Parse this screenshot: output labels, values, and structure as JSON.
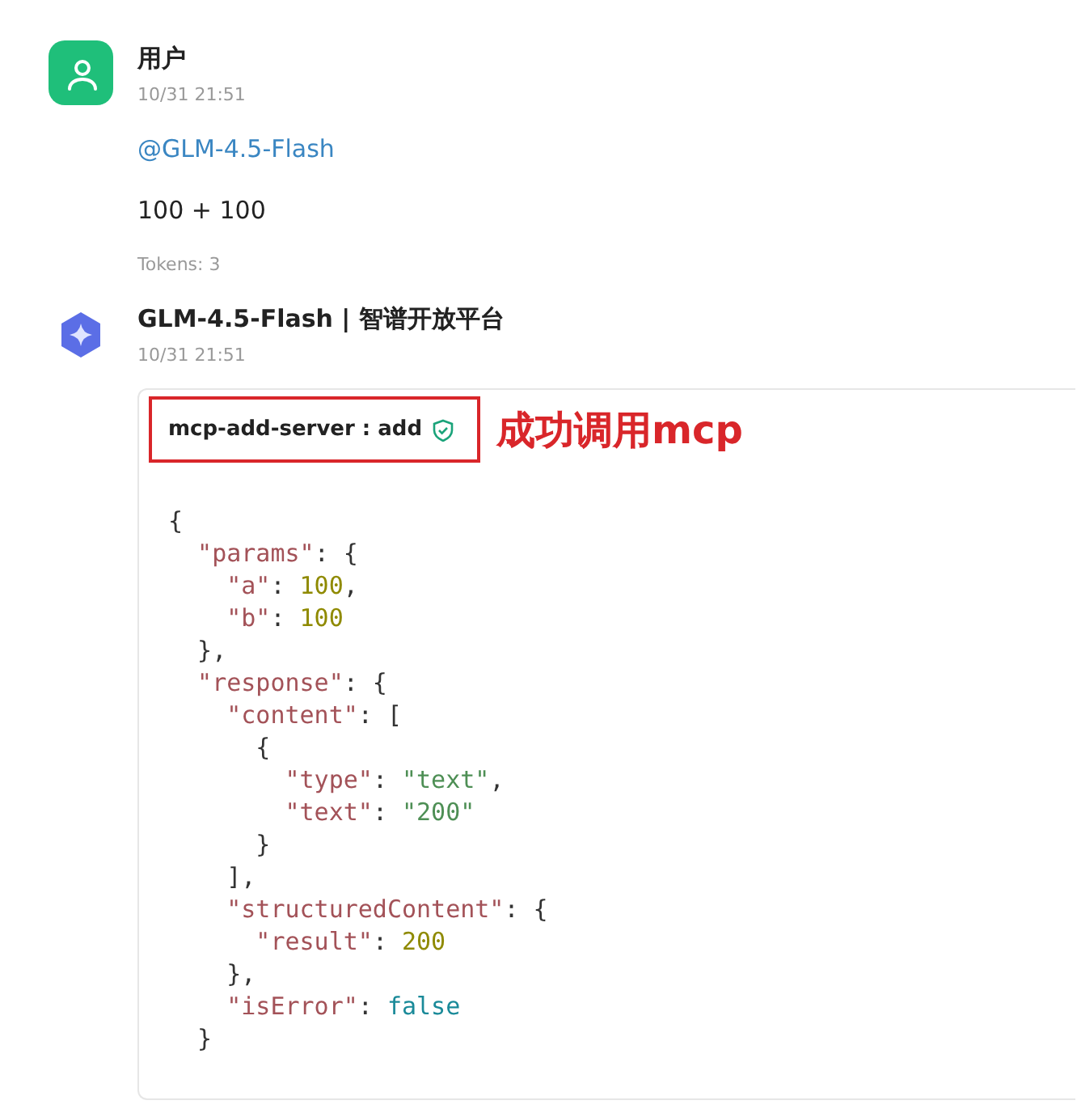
{
  "messages": [
    {
      "kind": "user",
      "author": "用户",
      "time": "10/31 21:51",
      "mention": "@GLM-4.5-Flash",
      "body": "100 + 100",
      "tokens": "Tokens: 3"
    },
    {
      "kind": "assistant",
      "author": "GLM-4.5-Flash | 智谱开放平台",
      "time": "10/31 21:51",
      "tool_call": {
        "name": "mcp-add-server : add",
        "verified": true,
        "annotation": "成功调用mcp",
        "code_lines": [
          [
            {
              "kind": "punct",
              "text": "{"
            }
          ],
          [
            {
              "kind": "key",
              "text": "  \"params\""
            },
            {
              "kind": "punct",
              "text": ": {"
            }
          ],
          [
            {
              "kind": "key",
              "text": "    \"a\""
            },
            {
              "kind": "punct",
              "text": ": "
            },
            {
              "kind": "number",
              "text": "100"
            },
            {
              "kind": "punct",
              "text": ","
            }
          ],
          [
            {
              "kind": "key",
              "text": "    \"b\""
            },
            {
              "kind": "punct",
              "text": ": "
            },
            {
              "kind": "number",
              "text": "100"
            }
          ],
          [
            {
              "kind": "punct",
              "text": "  },"
            }
          ],
          [
            {
              "kind": "key",
              "text": "  \"response\""
            },
            {
              "kind": "punct",
              "text": ": {"
            }
          ],
          [
            {
              "kind": "key",
              "text": "    \"content\""
            },
            {
              "kind": "punct",
              "text": ": ["
            }
          ],
          [
            {
              "kind": "punct",
              "text": "      {"
            }
          ],
          [
            {
              "kind": "key",
              "text": "        \"type\""
            },
            {
              "kind": "punct",
              "text": ": "
            },
            {
              "kind": "string",
              "text": "\"text\""
            },
            {
              "kind": "punct",
              "text": ","
            }
          ],
          [
            {
              "kind": "key",
              "text": "        \"text\""
            },
            {
              "kind": "punct",
              "text": ": "
            },
            {
              "kind": "string",
              "text": "\"200\""
            }
          ],
          [
            {
              "kind": "punct",
              "text": "      }"
            }
          ],
          [
            {
              "kind": "punct",
              "text": "    ],"
            }
          ],
          [
            {
              "kind": "key",
              "text": "    \"structuredContent\""
            },
            {
              "kind": "punct",
              "text": ": {"
            }
          ],
          [
            {
              "kind": "key",
              "text": "      \"result\""
            },
            {
              "kind": "punct",
              "text": ": "
            },
            {
              "kind": "number",
              "text": "200"
            }
          ],
          [
            {
              "kind": "punct",
              "text": "    },"
            }
          ],
          [
            {
              "kind": "key",
              "text": "    \"isError\""
            },
            {
              "kind": "punct",
              "text": ": "
            },
            {
              "kind": "keyword",
              "text": "false"
            }
          ],
          [
            {
              "kind": "punct",
              "text": "  }"
            }
          ]
        ]
      }
    }
  ]
}
